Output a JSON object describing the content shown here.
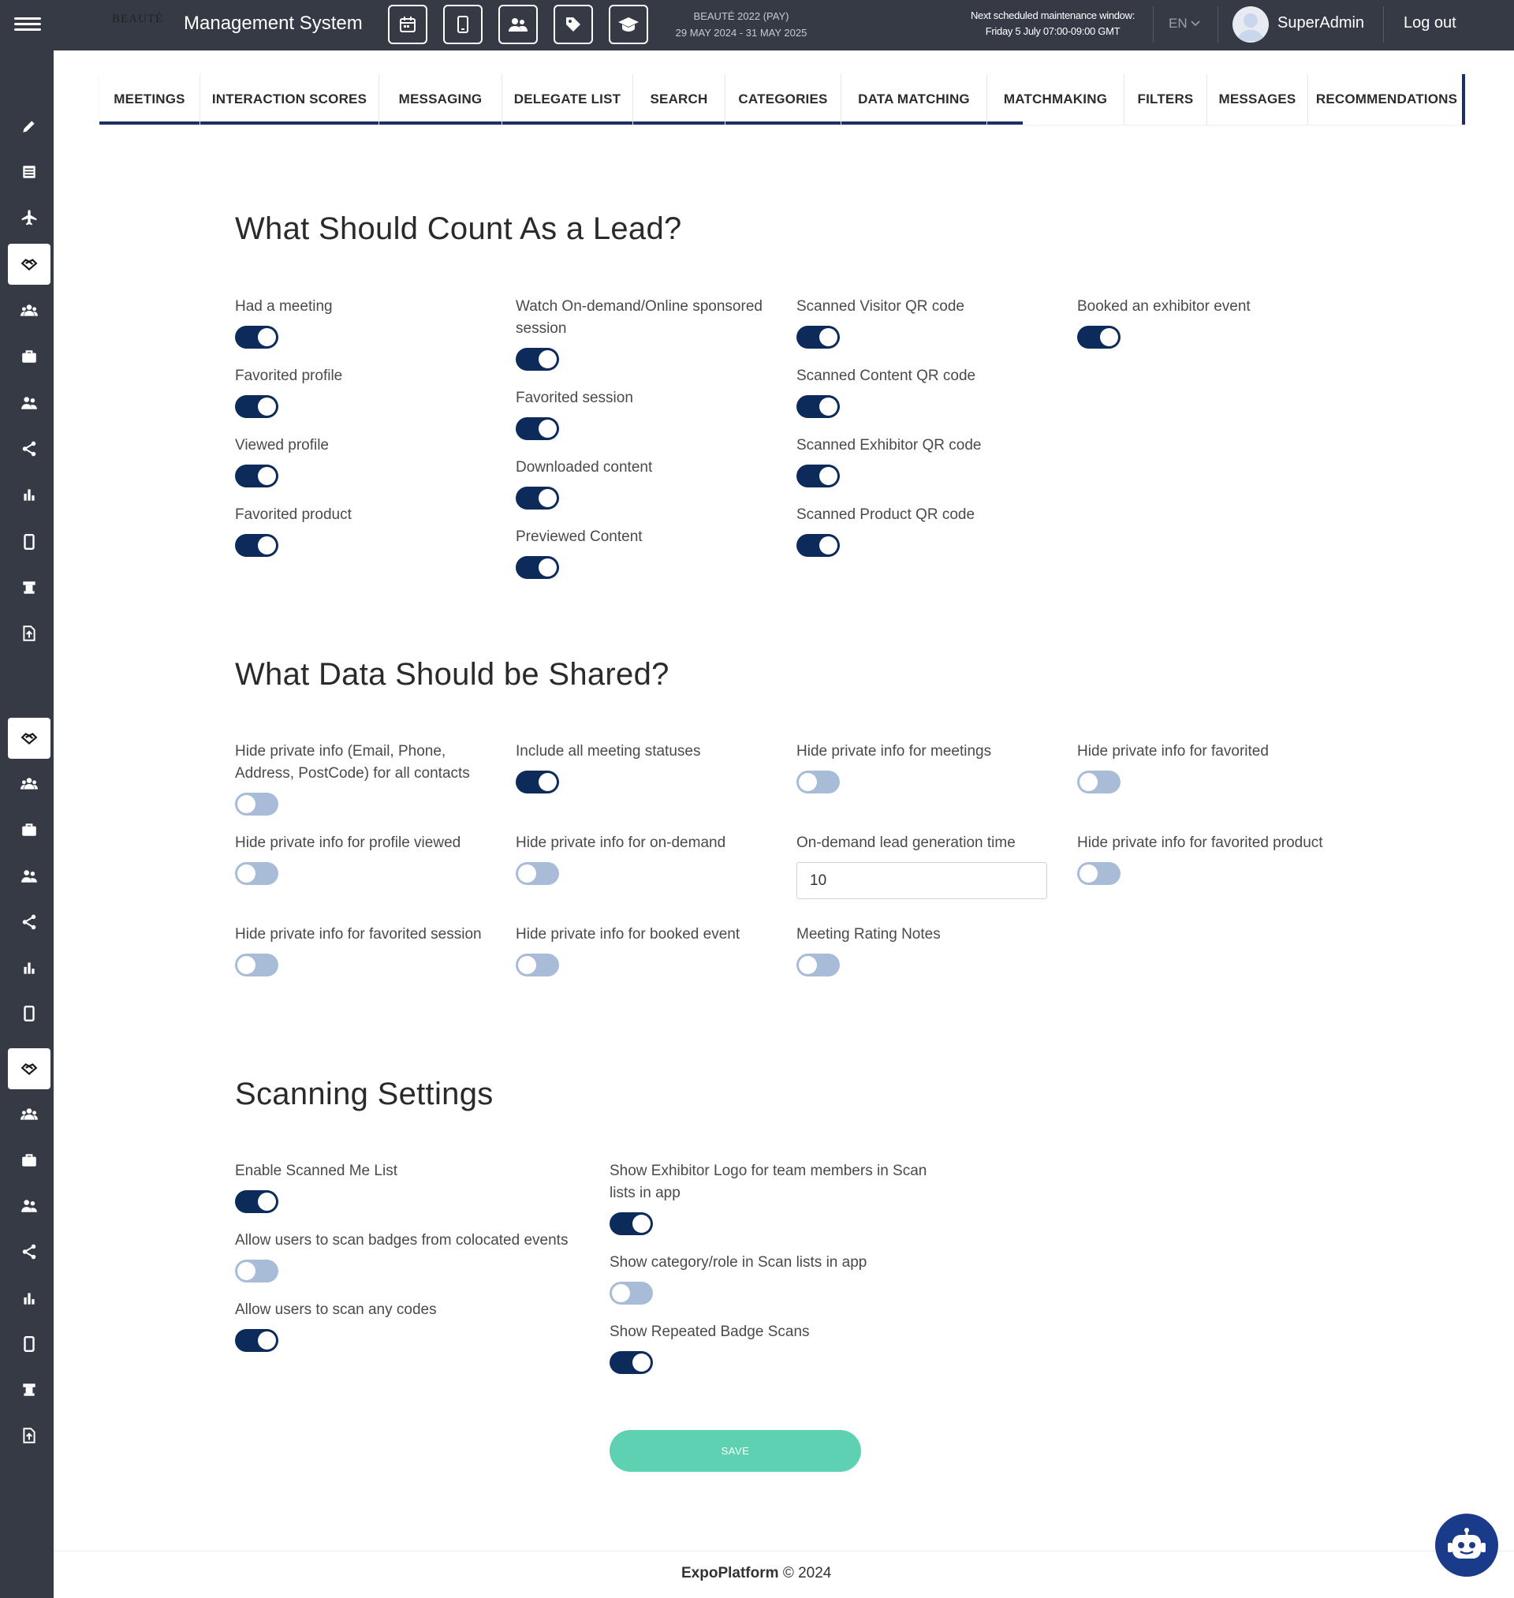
{
  "header": {
    "logo_text": "BEAUTÉ",
    "app_title": "Management System",
    "quick_buttons": [
      "calendar-icon",
      "mobile-icon",
      "users-icon",
      "tag-icon",
      "graduation-cap-icon"
    ],
    "event_name": "BEAUTÉ 2022 (PAY)",
    "event_dates": "29 MAY 2024 - 31 MAY 2025",
    "maintenance_title": "Next scheduled maintenance window:",
    "maintenance_time": "Friday 5 July 07:00-09:00 GMT",
    "language": "EN",
    "user_name": "SuperAdmin",
    "logout_label": "Log out"
  },
  "sidebar": {
    "items": [
      {
        "icon": "pencil-icon",
        "active": false
      },
      {
        "icon": "list-icon",
        "active": false
      },
      {
        "icon": "plane-icon",
        "active": false
      },
      {
        "icon": "handshake-icon",
        "active": true
      },
      {
        "icon": "group-icon",
        "active": false
      },
      {
        "icon": "briefcase-icon",
        "active": false
      },
      {
        "icon": "people-icon",
        "active": false
      },
      {
        "icon": "share-icon",
        "active": false
      },
      {
        "icon": "bar-chart-icon",
        "active": false
      },
      {
        "icon": "mobile-icon",
        "active": false
      },
      {
        "icon": "booth-icon",
        "active": false
      },
      {
        "icon": "file-upload-icon",
        "active": false
      },
      {
        "icon": "handshake-icon",
        "active": true
      },
      {
        "icon": "group-icon",
        "active": false
      },
      {
        "icon": "briefcase-icon",
        "active": false
      },
      {
        "icon": "people-icon",
        "active": false
      },
      {
        "icon": "share-icon",
        "active": false
      },
      {
        "icon": "bar-chart-icon",
        "active": false
      },
      {
        "icon": "mobile-icon",
        "active": false
      },
      {
        "icon": "handshake-icon",
        "active": true
      },
      {
        "icon": "group-icon",
        "active": false
      },
      {
        "icon": "briefcase-icon",
        "active": false
      },
      {
        "icon": "people-icon",
        "active": false
      },
      {
        "icon": "share-icon",
        "active": false
      },
      {
        "icon": "bar-chart-icon",
        "active": false
      },
      {
        "icon": "mobile-icon",
        "active": false
      },
      {
        "icon": "booth-icon",
        "active": false
      },
      {
        "icon": "file-upload-icon",
        "active": false
      }
    ]
  },
  "tabs": [
    "MEETINGS",
    "INTERACTION SCORES",
    "MESSAGING",
    "DELEGATE LIST",
    "SEARCH",
    "CATEGORIES",
    "DATA MATCHING",
    "MATCHMAKING",
    "FILTERS",
    "MESSAGES",
    "RECOMMENDATIONS"
  ],
  "lead": {
    "title": "What Should Count As a Lead?",
    "options": [
      {
        "label": "Had a meeting",
        "on": true
      },
      {
        "label": "Favorited profile",
        "on": true
      },
      {
        "label": "Viewed profile",
        "on": true
      },
      {
        "label": "Favorited product",
        "on": true
      },
      {
        "label": "Watch On-demand/Online sponsored session",
        "on": true
      },
      {
        "label": "Favorited session",
        "on": true
      },
      {
        "label": "Downloaded content",
        "on": true
      },
      {
        "label": "Previewed Content",
        "on": true
      },
      {
        "label": "Scanned Visitor QR code",
        "on": true
      },
      {
        "label": "Scanned Content QR code",
        "on": true
      },
      {
        "label": "Scanned Exhibitor QR code",
        "on": true
      },
      {
        "label": "Scanned Product QR code",
        "on": true
      },
      {
        "label": "Booked an exhibitor event",
        "on": true
      }
    ]
  },
  "shared": {
    "title": "What Data Should be Shared?",
    "options": [
      {
        "label": "Hide private info (Email, Phone, Address, PostCode) for all contacts",
        "on": false
      },
      {
        "label": "Hide private info for profile viewed",
        "on": false
      },
      {
        "label": "Hide private info for favorited session",
        "on": false
      },
      {
        "label": "Include all meeting statuses",
        "on": true
      },
      {
        "label": "Hide private info for on-demand",
        "on": false
      },
      {
        "label": "Hide private info for booked event",
        "on": false
      },
      {
        "label": "Hide private info for meetings",
        "on": false
      },
      {
        "label": "On-demand lead generation time",
        "on": null
      },
      {
        "label": "Meeting Rating Notes",
        "on": false
      },
      {
        "label": "Hide private info for favorited",
        "on": false
      },
      {
        "label": "Hide private info for favorited product",
        "on": false
      }
    ],
    "lead_time_value": "10"
  },
  "scanning": {
    "title": "Scanning Settings",
    "options": [
      {
        "label": "Enable Scanned Me List",
        "on": true
      },
      {
        "label": "Allow users to scan badges from colocated events",
        "on": false
      },
      {
        "label": "Allow users to scan any codes",
        "on": true
      },
      {
        "label": "Show Exhibitor Logo for team members in Scan lists in app",
        "on": true
      },
      {
        "label": "Show category/role in Scan lists in app",
        "on": false
      },
      {
        "label": "Show Repeated Badge Scans",
        "on": true
      }
    ]
  },
  "save_label": "SAVE",
  "footer": {
    "brand": "ExpoPlatform",
    "copyright": "© 2024"
  },
  "colors": {
    "dark": "#353a45",
    "navy": "#0d2b5a",
    "toggle_off": "#a8bcd8",
    "save": "#5ed1b3",
    "chatbot": "#1a3a8a"
  }
}
